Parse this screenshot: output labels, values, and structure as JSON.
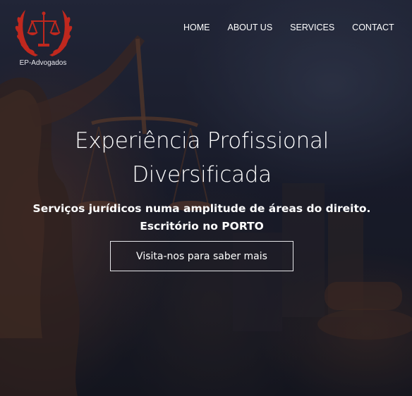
{
  "logo": {
    "text": "EP-Advogados",
    "icon": "scales-laurel-icon",
    "color": "#c0281e"
  },
  "nav": {
    "items": [
      {
        "label": "HOME"
      },
      {
        "label": "ABOUT US"
      },
      {
        "label": "SERVICES"
      },
      {
        "label": "CONTACT"
      }
    ]
  },
  "hero": {
    "headline_line1": "Experiência Profissional",
    "headline_line2": "Diversificada",
    "subtitle_line1": "Serviços jurídicos numa amplitude de áreas do direito.",
    "subtitle_line2": "Escritório no PORTO",
    "cta_label": "Visita-nos para saber mais"
  },
  "colors": {
    "text": "#ffffff",
    "background": "#1e2232",
    "accent": "#c0281e"
  }
}
